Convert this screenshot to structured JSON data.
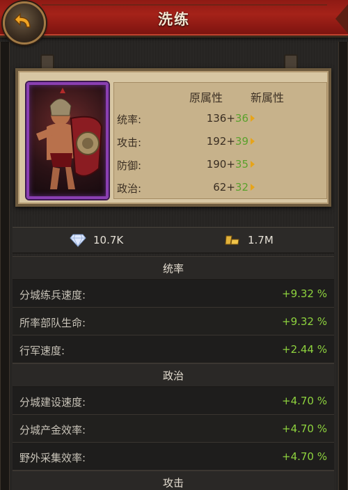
{
  "header": {
    "title": "洗练",
    "back_icon": "back-arrow-icon"
  },
  "hero": {
    "col_original": "原属性",
    "col_new": "新属性",
    "stats": [
      {
        "label": "统率:",
        "base": "136+",
        "bonus": "36"
      },
      {
        "label": "攻击:",
        "base": "192+",
        "bonus": "39"
      },
      {
        "label": "防御:",
        "base": "190+",
        "bonus": "35"
      },
      {
        "label": "政治:",
        "base": "62+",
        "bonus": "32"
      }
    ],
    "frame_color": "#8a3fb2"
  },
  "resources": {
    "diamond": "10.7K",
    "gold": "1.7M"
  },
  "sections": [
    {
      "title": "统率",
      "rows": [
        {
          "label": "分城练兵速度:",
          "value": "+9.32 %"
        },
        {
          "label": "所率部队生命:",
          "value": "+9.32 %"
        },
        {
          "label": "行军速度:",
          "value": "+2.44 %"
        }
      ]
    },
    {
      "title": "政治",
      "rows": [
        {
          "label": "分城建设速度:",
          "value": "+4.70 %"
        },
        {
          "label": "分城产金效率:",
          "value": "+4.70 %"
        },
        {
          "label": "野外采集效率:",
          "value": "+4.70 %"
        }
      ]
    },
    {
      "title": "攻击",
      "rows": []
    }
  ],
  "colors": {
    "accent_red": "#a52219",
    "bonus_green": "#5aa12c",
    "value_green": "#8ed33e"
  }
}
